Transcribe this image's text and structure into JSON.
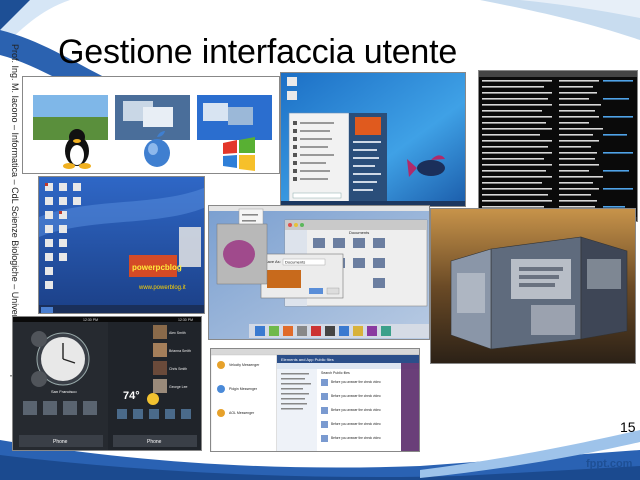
{
  "slide": {
    "title": "Gestione interfaccia utente",
    "side_text": "Prof. Ing. M. Iacono – Informatica – CdL Scienze Biologiche – Università della Campania \"L. Vanvitelli\"",
    "page_number": "15",
    "footer_logo": "fppt.com"
  },
  "shots": {
    "os_logos": {
      "caption": ""
    },
    "win7": {
      "user": "Biancaluna",
      "menu": [
        "Getting Started",
        "Windows Media Center",
        "Calculator",
        "Sticky Notes",
        "Snipping Tool",
        "Paint",
        "Remote Desktop",
        "Magnifier",
        "Solitaire",
        "All Programs"
      ],
      "right_menu": [
        "Documents",
        "Pictures",
        "Music",
        "Games",
        "Computer",
        "Control Panel",
        "Devices and Printers",
        "Default Programs",
        "Help and Support"
      ]
    },
    "terminal": {
      "lines": 24
    },
    "kde": {
      "logo_text": "powerpcblog",
      "url_text": "www.powerblog.it"
    },
    "mac": {
      "folder": "Documents",
      "dialog_label": "Save As:",
      "dialog_value": "Documents"
    },
    "cube": {},
    "htc": {
      "city": "San Francisco",
      "temp": "74°",
      "contacts": [
        "Alex Smith",
        "Brianna Smith",
        "Chris Smith",
        "George Lee"
      ],
      "buttons": [
        "Phone",
        "Phone"
      ],
      "time1": "12:30 PM",
      "time2": "12:30 PM"
    },
    "messenger": {
      "title": "Elements and App Public files",
      "items": [
        "Velocity Messenger",
        "Pidgin Messenger",
        "AOL Messenger"
      ],
      "search": "Search Public files",
      "rows": [
        "Before you answer the check video",
        "Before you answer the check video",
        "Before you answer the check video",
        "Before you answer the check video",
        "Before you answer the check video"
      ]
    }
  },
  "colors": {
    "accent_blue": "#1e4f94",
    "swoosh_light": "#9ec3ea",
    "swoosh_dark": "#1d5ba8"
  }
}
